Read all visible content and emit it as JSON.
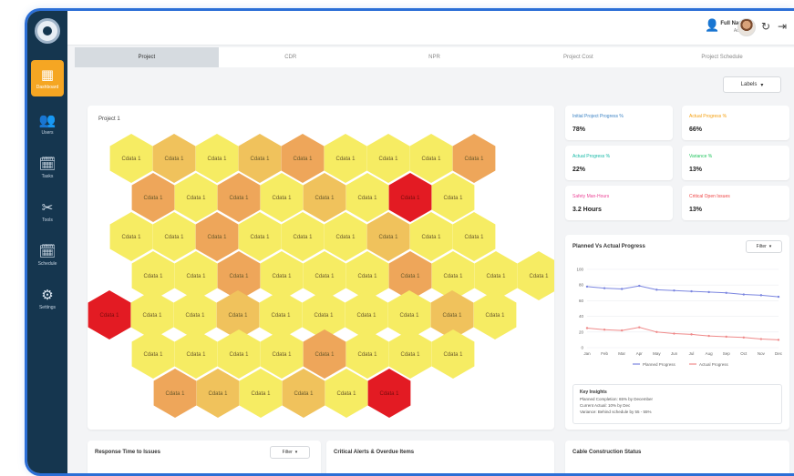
{
  "sidebar": {
    "items": [
      {
        "icon": "dashboard-icon",
        "glyph": "▦",
        "label": "Dashboard"
      },
      {
        "icon": "users-icon",
        "glyph": "👥",
        "label": "Users"
      },
      {
        "icon": "tasks-icon",
        "glyph": "🗓",
        "label": "Tasks"
      },
      {
        "icon": "tools-icon",
        "glyph": "✂",
        "label": "Tools"
      },
      {
        "icon": "schedule-icon",
        "glyph": "🗓",
        "label": "Schedule"
      },
      {
        "icon": "settings-icon",
        "glyph": "⚙",
        "label": "Settings"
      }
    ]
  },
  "topbar": {
    "user_name": "Full Name",
    "user_role": "Admin"
  },
  "tabs": [
    "Project",
    "CDR",
    "NPR",
    "Project Cost",
    "Project Schedule"
  ],
  "language_label": "Labels",
  "hex_panel": {
    "title": "Project 1",
    "label": "Cdata 1",
    "colors": {
      "low": "#f6ec63",
      "mid": "#f0c25c",
      "high": "#eea65a",
      "critical": "#e31b23"
    },
    "rows": [
      [
        "low",
        "mid",
        "low",
        "mid",
        "high",
        "low",
        "low",
        "low",
        "high"
      ],
      [
        "high",
        "low",
        "high",
        "low",
        "mid",
        "low",
        "critical",
        "low"
      ],
      [
        "low",
        "low",
        "high",
        "low",
        "low",
        "low",
        "mid",
        "low",
        "low"
      ],
      [
        "low",
        "low",
        "high",
        "low",
        "low",
        "low",
        "high",
        "low",
        "low",
        "low"
      ],
      [
        "critical",
        "low",
        "low",
        "mid",
        "low",
        "low",
        "low",
        "low",
        "mid",
        "low"
      ],
      [
        "low",
        "low",
        "low",
        "low",
        "high",
        "low",
        "low",
        "low"
      ],
      [
        "high",
        "mid",
        "low",
        "mid",
        "low",
        "critical"
      ]
    ]
  },
  "kpis": [
    {
      "title": "Initial Project Progress %",
      "value": "78%",
      "color": "#3b82c4",
      "icon": "chart-icon"
    },
    {
      "title": "Actual Progress %",
      "value": "66%",
      "color": "#f59e0b",
      "icon": "trend-icon"
    },
    {
      "title": "Actual Progress %",
      "value": "22%",
      "color": "#14b8a6",
      "icon": "trend-icon"
    },
    {
      "title": "Variance %",
      "value": "13%",
      "color": "#22c55e",
      "icon": "target-icon"
    },
    {
      "title": "Safety Man-Hours",
      "value": "3.2 Hours",
      "color": "#ec4899",
      "icon": "clock-icon"
    },
    {
      "title": "Critical Open Issues",
      "value": "13%",
      "color": "#ef4444",
      "icon": "alert-icon"
    }
  ],
  "line_panel": {
    "title": "Planned Vs Actual Progress",
    "filter": "Filter",
    "insights_title": "Key Insights",
    "insights": [
      "Planned Completion: 65% by December",
      "Current Actual: 10% by Dec",
      "Variance: Behind schedule by 55 - 55%"
    ]
  },
  "chart_data": {
    "type": "line",
    "title": "Planned Vs Actual Progress",
    "x": [
      "Jan",
      "Feb",
      "Mar",
      "Apr",
      "May",
      "Jun",
      "Jul",
      "Aug",
      "Sep",
      "Oct",
      "Nov",
      "Dec"
    ],
    "ylim": [
      0,
      100
    ],
    "yticks": [
      0,
      20,
      40,
      60,
      80,
      100
    ],
    "series": [
      {
        "name": "Planned Progress",
        "color": "#7b86e0",
        "values": [
          78,
          76,
          75,
          79,
          74,
          73,
          72,
          71,
          70,
          68,
          67,
          65
        ]
      },
      {
        "name": "Actual Progress",
        "color": "#ef8a8a",
        "values": [
          25,
          23,
          22,
          26,
          20,
          18,
          17,
          15,
          14,
          13,
          11,
          10
        ]
      }
    ],
    "legend": "bottom",
    "grid": true
  },
  "bottom": {
    "left_title": "Response Time to Issues",
    "left_filter": "Filter",
    "mid_title": "Critical Alerts & Overdue Items",
    "right_title": "Cable Construction Status"
  }
}
